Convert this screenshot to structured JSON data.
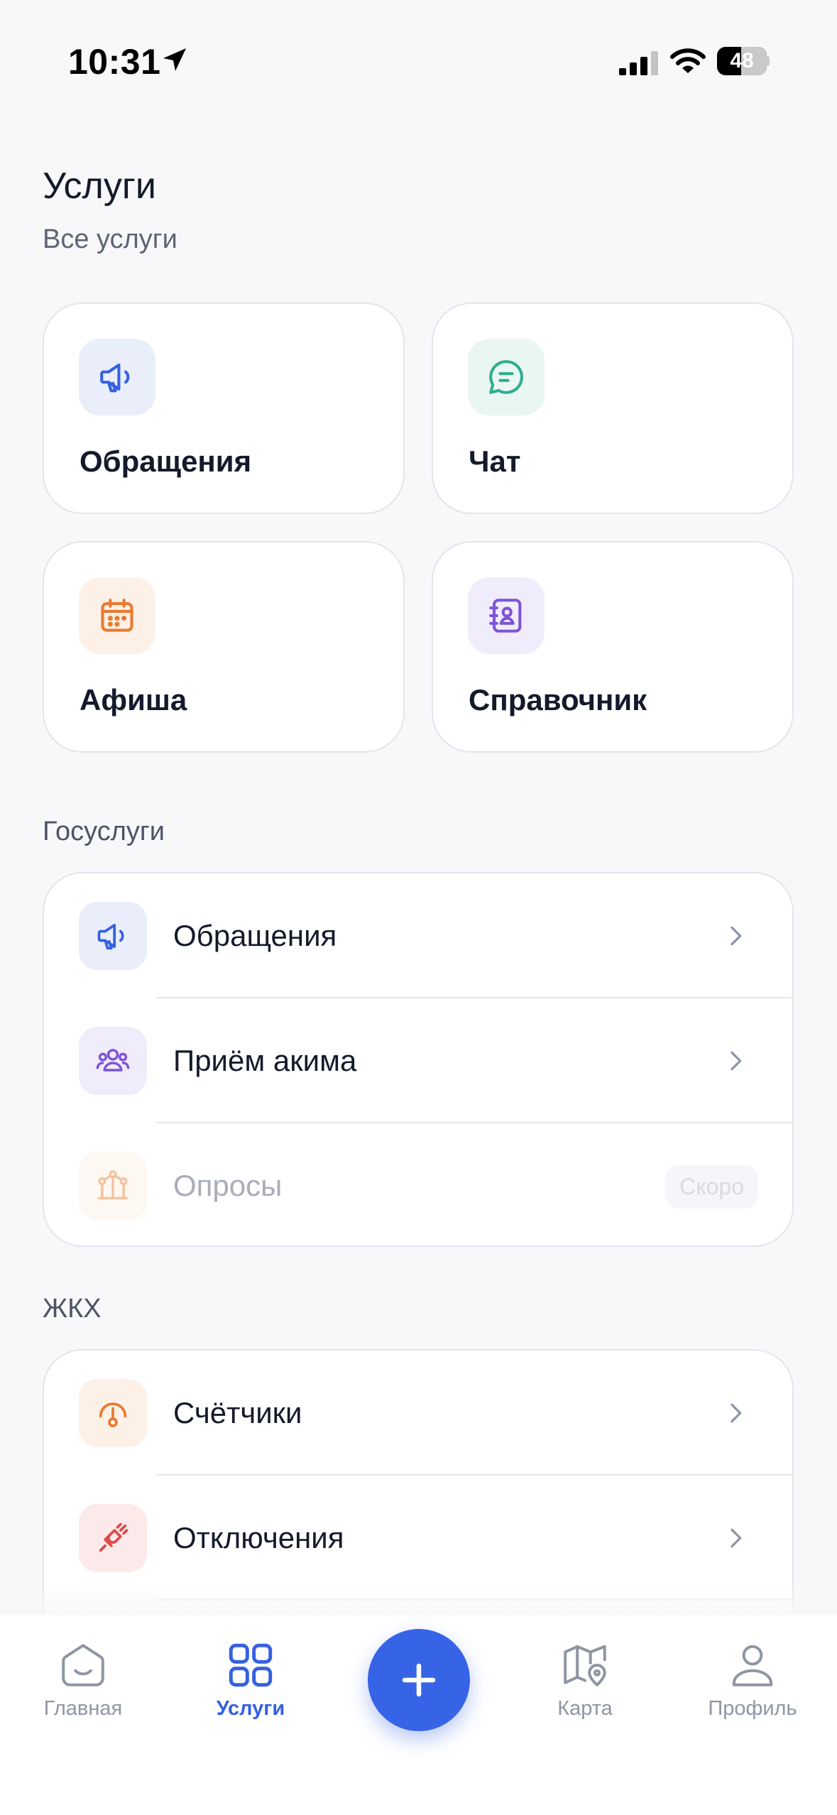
{
  "status_bar": {
    "time": "10:31",
    "battery": "48",
    "battery_level": 0.48
  },
  "header": {
    "title": "Услуги",
    "subtitle": "Все услуги"
  },
  "tiles": [
    {
      "label": "Обращения",
      "icon": "megaphone-icon",
      "color": "#3561e0",
      "bg": "#eaeefb"
    },
    {
      "label": "Чат",
      "icon": "chat-icon",
      "color": "#2fae8e",
      "bg": "#e9f6f2"
    },
    {
      "label": "Афиша",
      "icon": "calendar-icon",
      "color": "#e87b2f",
      "bg": "#fdf0e6"
    },
    {
      "label": "Справочник",
      "icon": "contact-book-icon",
      "color": "#7d55d6",
      "bg": "#f1ecfb"
    }
  ],
  "sections": {
    "gov": {
      "title": "Госуслуги",
      "items": [
        {
          "label": "Обращения",
          "icon": "megaphone-icon",
          "color": "#3561e0",
          "bg": "#eaeefb"
        },
        {
          "label": "Приём акима",
          "icon": "people-icon",
          "color": "#7d55d6",
          "bg": "#f1ecfb"
        },
        {
          "label": "Опросы",
          "icon": "poll-icon",
          "color": "#e87b2f",
          "bg": "#fdf0e6",
          "badge": "Скоро",
          "disabled": true
        }
      ]
    },
    "housing": {
      "title": "ЖКХ",
      "items": [
        {
          "label": "Счётчики",
          "icon": "meter-icon",
          "color": "#e87b2f",
          "bg": "#fdf0e6"
        },
        {
          "label": "Отключения",
          "icon": "unplug-icon",
          "color": "#e04848",
          "bg": "#fceaea"
        }
      ]
    }
  },
  "tab_bar": {
    "items": [
      {
        "label": "Главная",
        "icon": "home-icon"
      },
      {
        "label": "Услуги",
        "icon": "grid-icon",
        "active": true
      },
      {
        "label": "",
        "icon": "plus-icon"
      },
      {
        "label": "Карта",
        "icon": "map-icon"
      },
      {
        "label": "Профиль",
        "icon": "profile-icon"
      }
    ],
    "accent": "#3561e0"
  }
}
